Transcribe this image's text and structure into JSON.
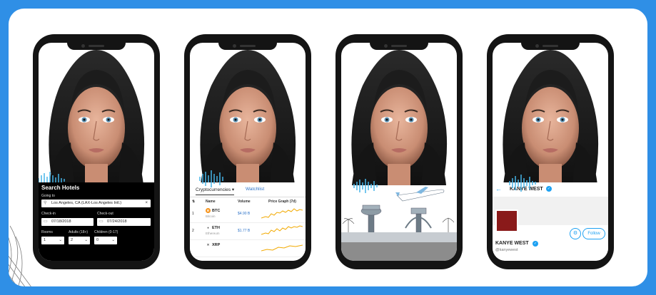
{
  "colors": {
    "frame_blue": "#2f8fe6",
    "twitter_blue": "#1da1f2",
    "hotel_bg": "#000000",
    "wave_blue": "#45b4e8",
    "crypto_line": "#f2a900"
  },
  "phone1": {
    "form_title": "Search Hotels",
    "going_to_label": "Going to",
    "going_to_value": "Los Angeles, CA (LAX-Los Angeles Intl.)",
    "clear_glyph": "×",
    "checkin_label": "Check-in",
    "checkin_value": "07/18/2018",
    "checkout_label": "Check-out",
    "checkout_value": "07/24/2018",
    "rooms_label": "Rooms",
    "rooms_value": "1",
    "adults_label": "Adults (18+)",
    "adults_value": "2",
    "children_label": "Children (0-17)",
    "children_value": "0"
  },
  "phone2": {
    "tab_crypto": "Cryptocurrencies ▾",
    "tab_watchlist": "Watchlist",
    "col_sort": "⇅",
    "col_name": "Name",
    "col_volume": "Volume",
    "col_graph": "Price Graph (7d)",
    "rows": [
      {
        "rank": "1",
        "symbol": "BTC",
        "name": "Bitcoin",
        "volume": "$4.90 B",
        "coin_color": "#f7931a",
        "coin_glyph": "B"
      },
      {
        "rank": "2",
        "symbol": "ETH",
        "name": "Ethereum",
        "volume": "$1.77 B",
        "coin_color": "#444444",
        "coin_glyph": "♦"
      },
      {
        "rank": "",
        "symbol": "XRP",
        "name": "",
        "volume": "",
        "coin_color": "#444444",
        "coin_glyph": "✕"
      }
    ]
  },
  "phone4": {
    "back_arrow": "←",
    "header_name": "KANYE WEST",
    "profile_name": "KANYE WEST",
    "handle": "@kanyewest",
    "follow_label": "Follow"
  }
}
